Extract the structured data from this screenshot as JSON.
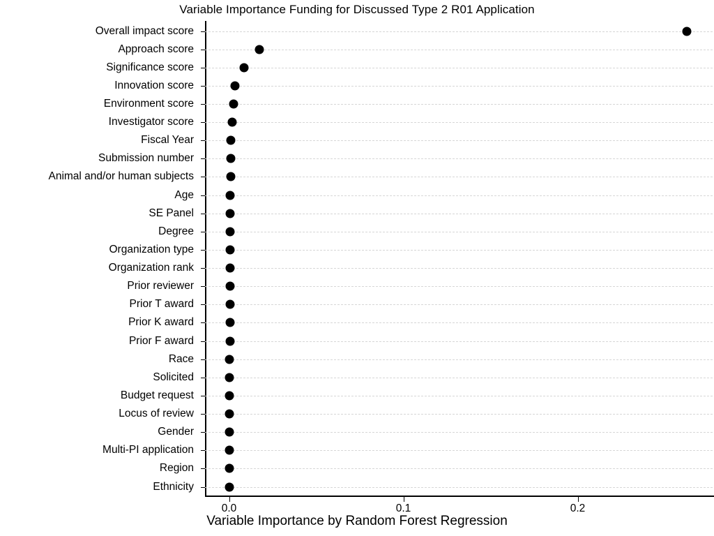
{
  "chart_data": {
    "type": "scatter",
    "title": "Variable Importance Funding for Discussed Type 2 R01 Application",
    "xlabel": "Variable Importance by Random Forest Regression",
    "ylabel": "",
    "orientation": "horizontal",
    "grid": "horizontal-dashed",
    "legend": "none",
    "xlim": [
      -0.0134,
      0.2778
    ],
    "xticks": [
      0.0,
      0.1,
      0.2
    ],
    "xticklabels": [
      "0.0",
      "0.1",
      "0.2"
    ],
    "marker": "filled-circle",
    "marker_color": "#000000",
    "categories": [
      "Overall impact score",
      "Approach score",
      "Significance score",
      "Innovation score",
      "Environment score",
      "Investigator score",
      "Fiscal Year",
      "Submission number",
      "Animal and/or human subjects",
      "Age",
      "SE Panel",
      "Degree",
      "Organization type",
      "Organization rank",
      "Prior reviewer",
      "Prior T award",
      "Prior K award",
      "Prior F award",
      "Race",
      "Solicited",
      "Budget request",
      "Locus of review",
      "Gender",
      "Multi-PI application",
      "Region",
      "Ethnicity"
    ],
    "values": [
      0.2626,
      0.0174,
      0.0086,
      0.0034,
      0.0026,
      0.0019,
      0.0011,
      0.0009,
      0.0008,
      0.0007,
      0.0007,
      0.0006,
      0.0006,
      0.0005,
      0.0005,
      0.0004,
      0.0004,
      0.0004,
      0.0003,
      0.0003,
      0.0003,
      0.0002,
      0.0002,
      0.0002,
      0.0001,
      0.0001
    ]
  }
}
